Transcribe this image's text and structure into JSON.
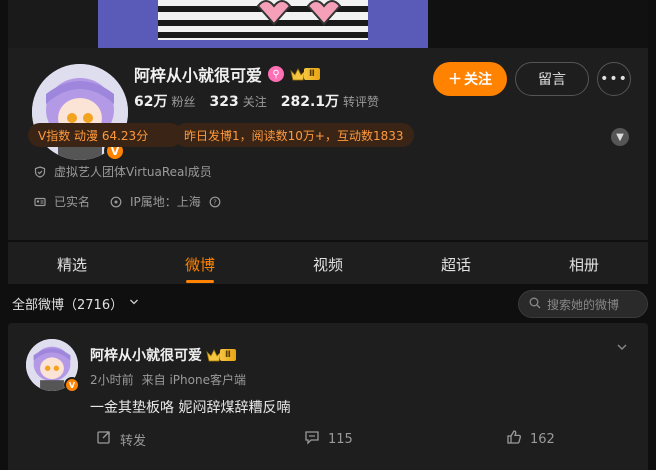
{
  "profile": {
    "name": "阿梓从小就很可爱",
    "level_badge": "Ⅱ",
    "verify_mark": "V",
    "pink_badge_glyph": "⚲",
    "stats": [
      {
        "value": "62万",
        "label": "粉丝"
      },
      {
        "value": "323",
        "label": "关注"
      },
      {
        "value": "282.1万",
        "label": "转评赞"
      }
    ],
    "follow_label": "关注",
    "message_label": "留言",
    "more_label": "•••",
    "chips": [
      "V指数 动漫 64.23分",
      "昨日发博1，阅读数10万+，互动数1833"
    ],
    "info": {
      "org": "虚拟艺人团体VirtuaReal成员",
      "realname": "已实名",
      "ip": "IP属地：上海"
    }
  },
  "tabs": [
    {
      "label": "精选"
    },
    {
      "label": "微博"
    },
    {
      "label": "视频"
    },
    {
      "label": "超话"
    },
    {
      "label": "相册"
    }
  ],
  "filter": {
    "label": "全部微博（2716）",
    "search_placeholder": "搜索她的微博"
  },
  "post": {
    "name": "阿梓从小就很可爱",
    "level_badge": "Ⅱ",
    "time": "2小时前",
    "source": "来自 iPhone客户端",
    "text": "一金其垫板咯 妮闷辞煤辞糟反喃",
    "repost_label": "转发",
    "comment_count": "115",
    "like_count": "162"
  },
  "colors": {
    "accent": "#ff8200",
    "background": "#0f0f0f",
    "card": "#1e1e1e",
    "chip_bg": "#3a2415",
    "chip_text": "#ff9a3c"
  },
  "icons": [
    "shield-icon",
    "id-card-icon",
    "location-icon",
    "help-icon",
    "search-icon",
    "repost-icon",
    "comment-icon",
    "like-icon",
    "chevron-down-icon"
  ]
}
